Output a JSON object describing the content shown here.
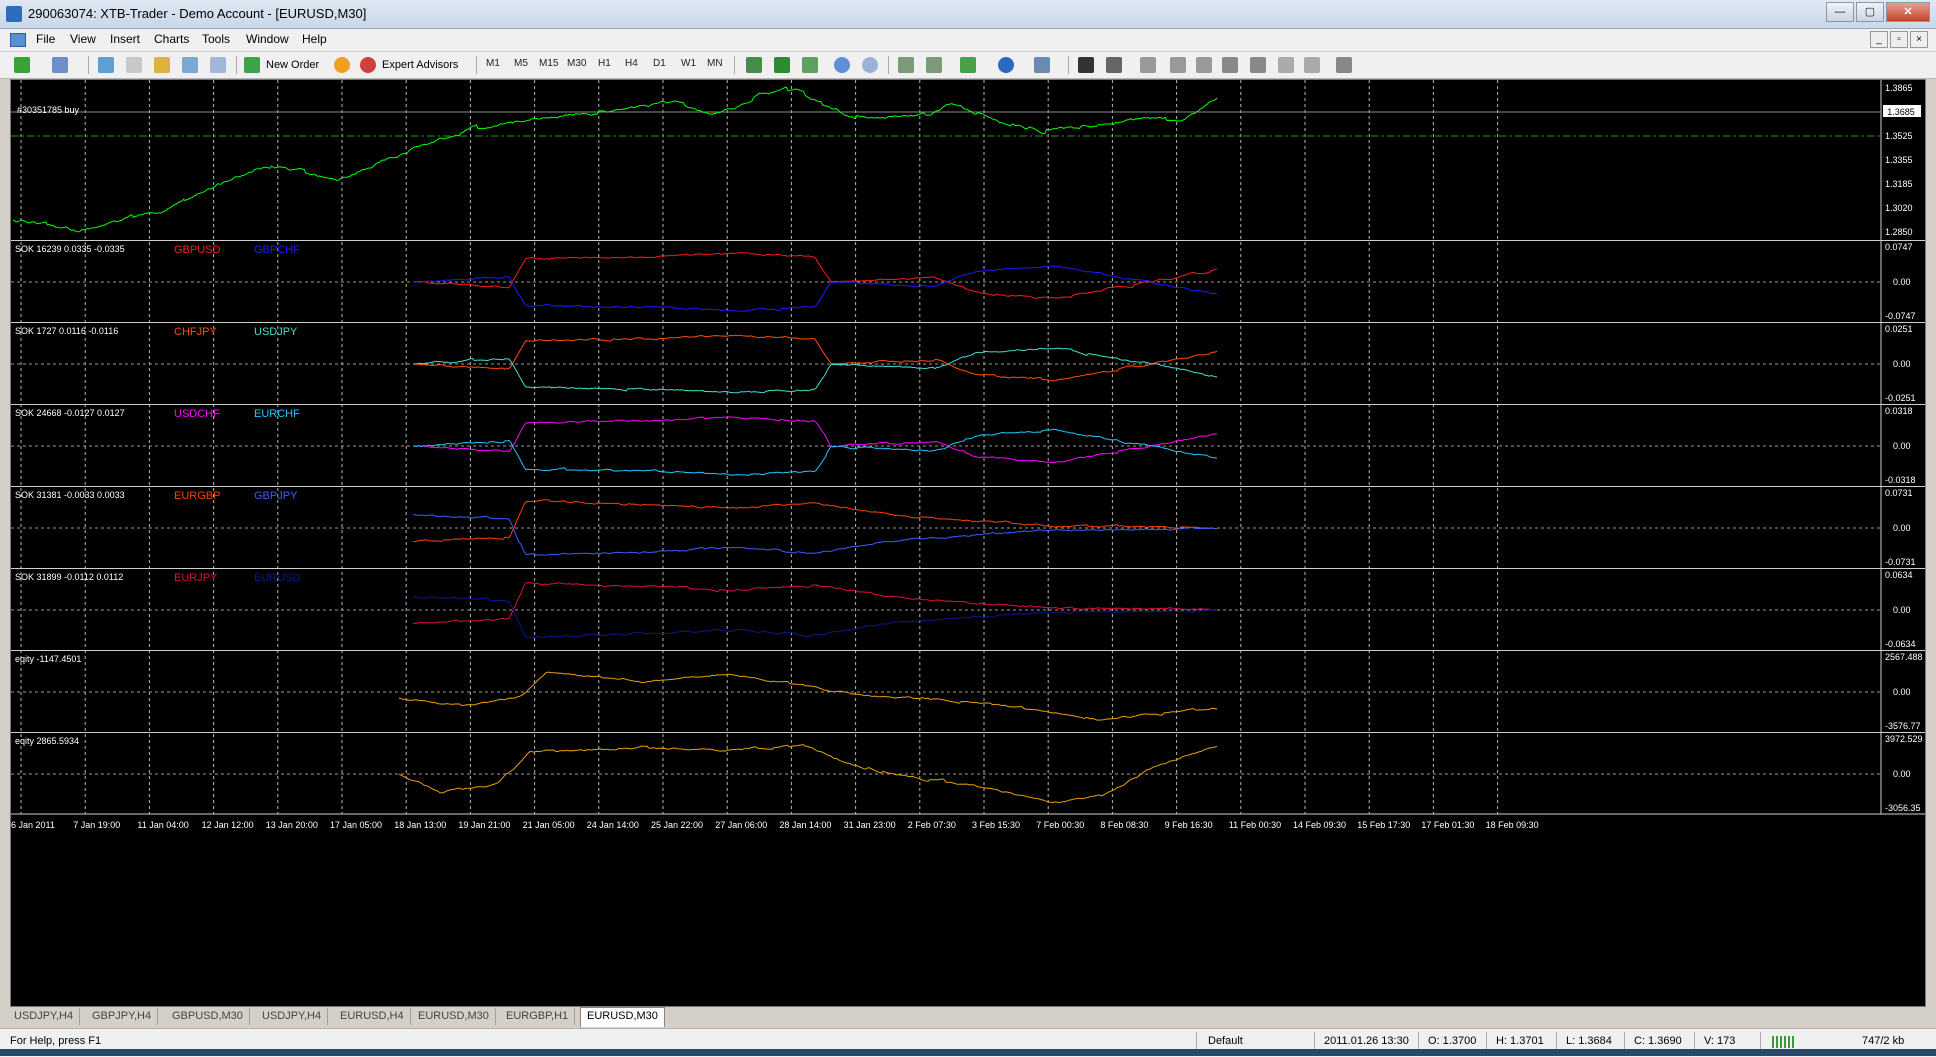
{
  "window": {
    "title": "290063074: XTB-Trader - Demo Account - [EURUSD,M30]",
    "controls": [
      "—",
      "▢",
      "✕"
    ]
  },
  "menu": [
    "File",
    "View",
    "Insert",
    "Charts",
    "Tools",
    "Window",
    "Help"
  ],
  "mdi_controls": [
    "_",
    "▫",
    "×"
  ],
  "toolbar": {
    "new_order": "New Order",
    "expert_advisors": "Expert Advisors",
    "timeframes": [
      "M1",
      "M5",
      "M15",
      "M30",
      "H1",
      "H4",
      "D1",
      "W1",
      "MN"
    ]
  },
  "main_chart": {
    "order_label": "#30351785 buy",
    "price_ticks": [
      "1.3865",
      "1.3685",
      "1.3525",
      "1.3355",
      "1.3185",
      "1.3020",
      "1.2850"
    ],
    "current_price": "1.3685",
    "line_color": "#00ff00"
  },
  "indicators": [
    {
      "label": "SOK 16239 0.0335 -0.0335",
      "a": "GBPUSD",
      "b": "GBPCHF",
      "ca": "#ff1a1a",
      "cb": "#1c1cff",
      "ticks": [
        "0.0747",
        "0.00",
        "-0.0747"
      ]
    },
    {
      "label": "SOK 1727 0.0116 -0.0116",
      "a": "CHFJPY",
      "b": "USDJPY",
      "ca": "#ff4d00",
      "cb": "#40e0d0",
      "ticks": [
        "0.0251",
        "0.00",
        "-0.0251"
      ]
    },
    {
      "label": "SOK 24668 -0.0127 0.0127",
      "a": "USDCHF",
      "b": "EURCHF",
      "ca": "#ff00ff",
      "cb": "#1ec8ff",
      "ticks": [
        "0.0318",
        "0.00",
        "-0.0318"
      ]
    },
    {
      "label": "SOK 31381 -0.0033 0.0033",
      "a": "EURGBP",
      "b": "GBPJPY",
      "ca": "#ff4000",
      "cb": "#3c5cff",
      "ticks": [
        "0.0731",
        "0.00",
        "-0.0731"
      ]
    },
    {
      "label": "SOK 31899 -0.0112 0.0112",
      "a": "EURJPY",
      "b": "EURUSD",
      "ca": "#e0103a",
      "cb": "#0a1a8c",
      "ticks": [
        "0.0634",
        "0.00",
        "-0.0634"
      ]
    }
  ],
  "equity_panes": [
    {
      "label": "eqity -1147.4501",
      "color": "#e6a000",
      "ticks": [
        "2567.488",
        "0.00",
        "-3576.77"
      ]
    },
    {
      "label": "eqity 2865.5934",
      "color": "#e6a000",
      "ticks": [
        "3972.529",
        "0.00",
        "-3056.35"
      ]
    }
  ],
  "time_axis": [
    "6 Jan 2011",
    "7 Jan 19:00",
    "11 Jan 04:00",
    "12 Jan 12:00",
    "13 Jan 20:00",
    "17 Jan 05:00",
    "18 Jan 13:00",
    "19 Jan 21:00",
    "21 Jan 05:00",
    "24 Jan 14:00",
    "25 Jan 22:00",
    "27 Jan 06:00",
    "28 Jan 14:00",
    "31 Jan 23:00",
    "2 Feb 07:30",
    "3 Feb 15:30",
    "7 Feb 00:30",
    "8 Feb 08:30",
    "9 Feb 16:30",
    "11 Feb 00:30",
    "14 Feb 09:30",
    "15 Feb 17:30",
    "17 Feb 01:30",
    "18 Feb 09:30"
  ],
  "tabs": [
    "USDJPY,H4",
    "GBPJPY,H4",
    "GBPUSD,M30",
    "USDJPY,H4",
    "EURUSD,H4",
    "EURUSD,M30",
    "EURGBP,H1",
    "EURUSD,M30"
  ],
  "active_tab": 7,
  "status": {
    "help": "For Help, press F1",
    "profile": "Default",
    "datetime": "2011.01.26 13:30",
    "open": "O: 1.3700",
    "high": "H: 1.3701",
    "low": "L: 1.3684",
    "close": "C: 1.3690",
    "volume": "V: 173",
    "traffic": "747/2 kb"
  }
}
